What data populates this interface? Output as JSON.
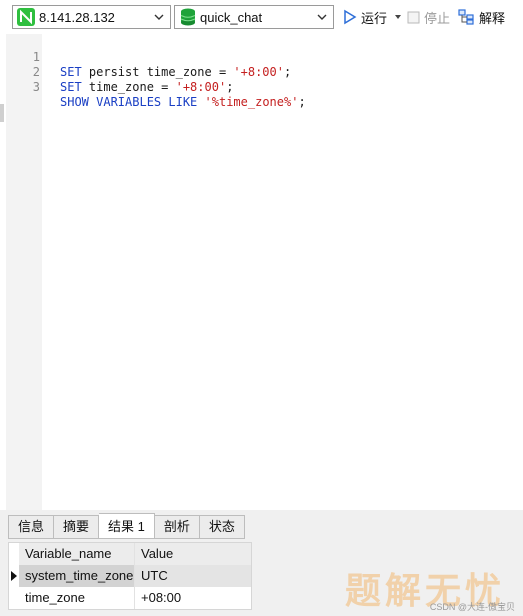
{
  "toolbar": {
    "connection": "8.141.28.132",
    "database": "quick_chat",
    "run_label": "运行",
    "stop_label": "停止",
    "explain_label": "解释"
  },
  "editor": {
    "lines": [
      {
        "num": "1",
        "parts": [
          "SET",
          " persist time_zone = ",
          "'+8:00'",
          ";"
        ]
      },
      {
        "num": "2",
        "parts": [
          "SET",
          " time_zone = ",
          "'+8:00'",
          ";"
        ]
      },
      {
        "num": "3",
        "parts": [
          "SHOW VARIABLES LIKE",
          " ",
          "'%time_zone%'",
          ";"
        ]
      }
    ]
  },
  "result_tabs": [
    "信息",
    "摘要",
    "结果 1",
    "剖析",
    "状态"
  ],
  "active_tab": "结果 1",
  "result_table": {
    "columns": [
      "Variable_name",
      "Value"
    ],
    "rows": [
      [
        "system_time_zone",
        "UTC"
      ],
      [
        "time_zone",
        "+08:00"
      ]
    ]
  },
  "watermark": "题解无忧",
  "credit": "CSDN @大连-傲宝贝",
  "colors": {
    "keyword": "#1a3fc4",
    "string": "#c41f1f",
    "connection_icon": "#2fbf3f",
    "database_icon": "#1ea33a",
    "run_icon": "#2e6fd8"
  }
}
